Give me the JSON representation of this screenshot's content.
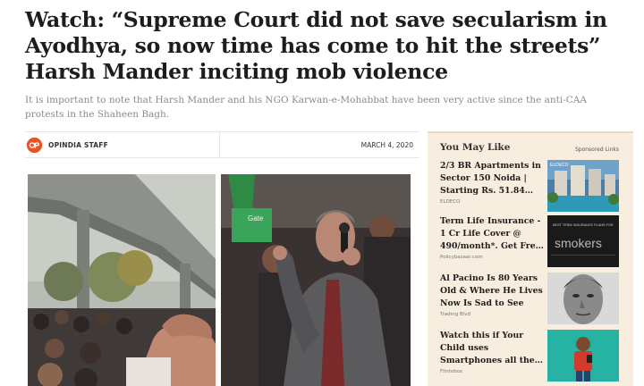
{
  "article": {
    "headline": "Watch: “Supreme Court did not save secularism in Ayodhya, so now time has come to hit the streets” Harsh Mander inciting mob violence",
    "subhead": "It is important to note that Harsh Mander and his NGO Karwan-e-Mohabbat have been very active since the anti-CAA protests in the Shaheen Bagh.",
    "author": "OPINDIA STAFF",
    "date": "MARCH 4, 2020",
    "author_logo_icon": "opindia-logo-icon"
  },
  "sidebar": {
    "title": "You May Like",
    "sponsored_label": "Sponsored Links",
    "ads": [
      {
        "title": "2/3 BR Apartments in Sector 150 Noida | Starting Rs. 51.84…",
        "source": "ELDECO",
        "thumb_label": "ELDECO"
      },
      {
        "title": "Term Life Insurance - 1 Cr Life Cover @ 490/month*. Get Fre…",
        "source": "Policybazaar.com",
        "thumb_label": "smokers",
        "thumb_caption": "BEST TERM INSURANCE PLANS FOR"
      },
      {
        "title": "Al Pacino Is 80 Years Old & Where He Lives Now Is Sad to See",
        "source": "Trading Blvd"
      },
      {
        "title": "Watch this if Your Child uses Smartphones all the…",
        "source": "Flintobox"
      }
    ]
  },
  "photos": {
    "right_sign_text": "Gate"
  },
  "colors": {
    "sidebar_bg": "#f8eedf",
    "brand_orange": "#e8531f",
    "subhead_gray": "#8a8a8a"
  }
}
